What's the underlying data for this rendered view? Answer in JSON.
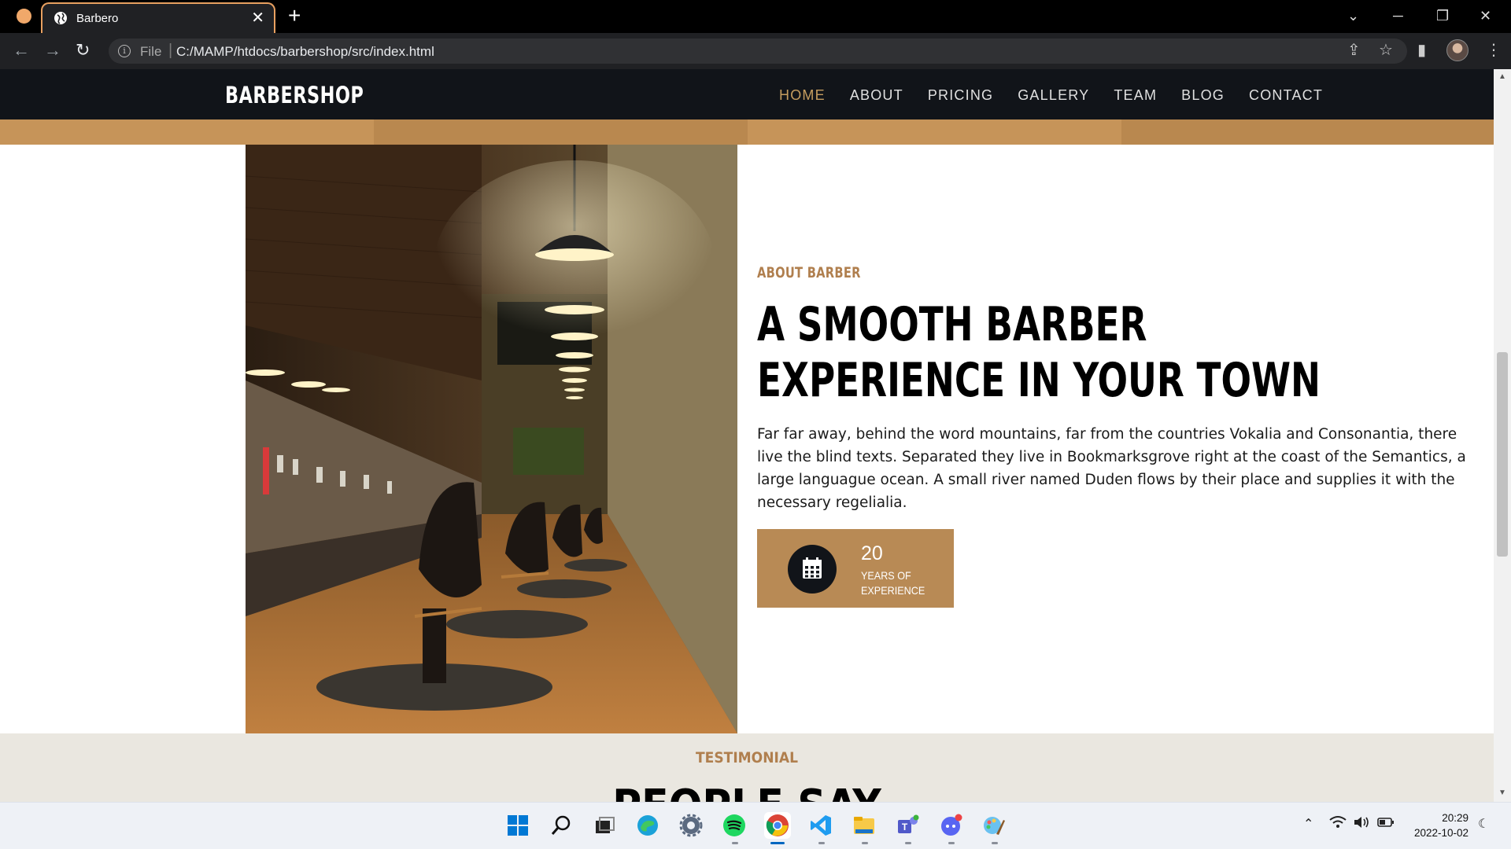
{
  "browser": {
    "tab_title": "Barbero",
    "tab_close": "✕",
    "new_tab": "+",
    "file_label": "File",
    "url": "C:/MAMP/htdocs/barbershop/src/index.html"
  },
  "site": {
    "brand": "BARBERSHOP",
    "menu": [
      "HOME",
      "ABOUT",
      "PRICING",
      "GALLERY",
      "TEAM",
      "BLOG",
      "CONTACT"
    ],
    "active_menu": "HOME",
    "accent_color": "#c59d5f",
    "nav_bg": "#111419"
  },
  "about": {
    "kicker": "ABOUT BARBER",
    "title": "A SMOOTH BARBER EXPERIENCE IN YOUR TOWN",
    "text": "Far far away, behind the word mountains, far from the countries Vokalia and Consonantia, there live the blind texts. Separated they live in Bookmarksgrove right at the coast of the Semantics, a large languague ocean. A small river named Duden flows by their place and supplies it with the necessary regelialia.",
    "experience_number": "20",
    "experience_label": "YEARS OF EXPERIENCE",
    "experience_icon": "calendar-icon"
  },
  "testimonial": {
    "kicker": "TESTIMONIAL",
    "title": "PEOPLE SAY"
  },
  "taskbar": {
    "apps": [
      "start",
      "search",
      "task-view",
      "edge",
      "settings",
      "spotify",
      "chrome",
      "vscode",
      "file-explorer",
      "teams",
      "discord",
      "paint"
    ],
    "time": "20:29",
    "date": "2022-10-02"
  }
}
